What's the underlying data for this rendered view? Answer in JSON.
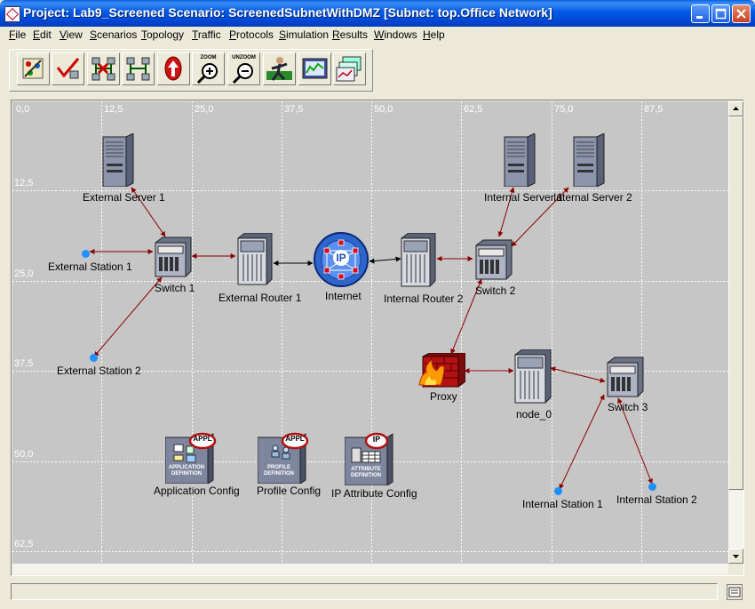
{
  "window": {
    "title": "Project: Lab9_Screened Scenario: ScreenedSubnetWithDMZ  [Subnet: top.Office Network]"
  },
  "menu": [
    "File",
    "Edit",
    "View",
    "Scenarios",
    "Topology",
    "Traffic",
    "Protocols",
    "Simulation",
    "Results",
    "Windows",
    "Help"
  ],
  "toolbar": {
    "zoom_label": "ZOOM",
    "unzoom_label": "UNZOOM"
  },
  "ruler": {
    "x": [
      "0,0",
      "12,5",
      "25,0",
      "37,5",
      "50,0",
      "62,5",
      "75,0",
      "87,5"
    ],
    "y": [
      "12,5",
      "25,0",
      "37,5",
      "50,0",
      "62,5"
    ]
  },
  "nodes": {
    "external_server_1": "External Server 1",
    "external_station_1": "External Station 1",
    "switch_1": "Switch 1",
    "external_station_2": "External Station 2",
    "external_router_1": "External Router 1",
    "internet": "Internet",
    "internet_badge": "IP",
    "internal_router_2": "Internal Router 2",
    "switch_2": "Switch 2",
    "internal_server_1": "Internal Server 1",
    "internal_server_2": "Internal Server 2",
    "proxy": "Proxy",
    "node_0": "node_0",
    "switch_3": "Switch 3",
    "internal_station_1": "Internal Station 1",
    "internal_station_2": "Internal Station 2",
    "application_config": "Application Config",
    "profile_config": "Profile Config",
    "ip_attribute_config": "IP Attribute Config"
  },
  "config_badges": {
    "appl": "APPL",
    "ip": "IP",
    "application_definition": [
      "APPLICATION",
      "DEFINITION"
    ],
    "profile_definition": [
      "PROFILE",
      "DEFINITION"
    ],
    "attribute_definition": [
      "ATTRIBUTE",
      "DEFINITION"
    ]
  },
  "colors": {
    "link": "#8b0000",
    "link_black": "#000000",
    "station": "#1e90ff",
    "canvas": "#c6c6c6"
  }
}
